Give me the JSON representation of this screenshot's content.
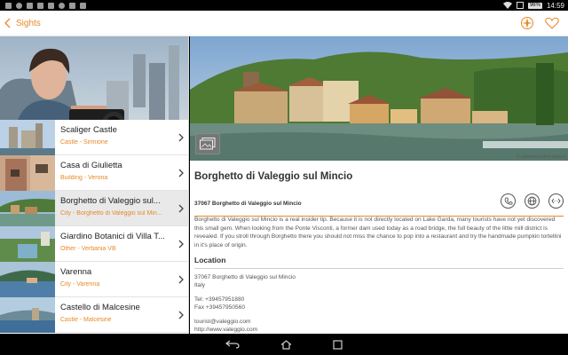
{
  "status_bar": {
    "battery": "96%",
    "time": "14:59"
  },
  "action_bar": {
    "title": "Sights",
    "accent_color": "#e8892a"
  },
  "list": {
    "items": [
      {
        "title": "Scaliger Castle",
        "subtitle": "Castle - Sirmione",
        "selected": false
      },
      {
        "title": "Casa di Giulietta",
        "subtitle": "Building - Verona",
        "selected": false
      },
      {
        "title": "Borghetto di Valeggio sul...",
        "subtitle": "City - Borghetto di Valeggio sul Min...",
        "selected": true
      },
      {
        "title": "Giardino Botanici di Villa T...",
        "subtitle": "Other - Verbania VB",
        "selected": false
      },
      {
        "title": "Varenna",
        "subtitle": "City - Varenna",
        "selected": false
      },
      {
        "title": "Castello di Malcesine",
        "subtitle": "Castle - Malcesine",
        "selected": false
      }
    ]
  },
  "detail": {
    "copyright": "© LianeM/iStock/Thinkstock",
    "title": "Borghetto di Valeggio sul Mincio",
    "address_line": "37067 Borghetto di Valeggio sul Mincio",
    "description": "Borghetto di Valeggio sul Mincio is a real insider tip. Because it is not directly located on Lake Garda, many tourists have not yet discovered this small gem. When looking from the Ponte Visconti, a former dam used today as a road bridge, the full beauty of the little mill district is revealed. If you stroll through Borghetto there you should not miss the chance to pop into a restaurant and try the handmade pumpkin tortellini in it's place of origin.",
    "location_heading": "Location",
    "location": {
      "street": "37067 Borghetto di Valeggio sul Mincio",
      "country": "Italy",
      "tel": "Tel: +39457951880",
      "fax": "Fax +39457950560",
      "email": "tourist@valeggio.com",
      "web": "http://www.valeggio.com"
    }
  }
}
